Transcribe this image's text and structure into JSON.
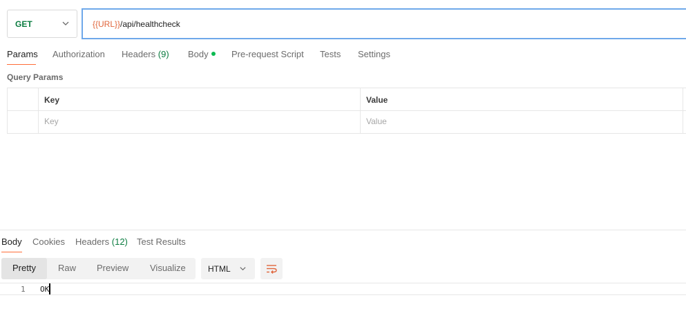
{
  "request": {
    "method": "GET",
    "url_variable": "{{URL}}",
    "url_path": "/api/healthcheck"
  },
  "request_tabs": {
    "params": "Params",
    "authorization": "Authorization",
    "headers": "Headers",
    "headers_count": "(9)",
    "body": "Body",
    "pre_request_script": "Pre-request Script",
    "tests": "Tests",
    "settings": "Settings"
  },
  "query_params": {
    "title": "Query Params",
    "columns": [
      "Key",
      "Value"
    ],
    "placeholders": [
      "Key",
      "Value"
    ]
  },
  "response_tabs": {
    "body": "Body",
    "cookies": "Cookies",
    "headers": "Headers",
    "headers_count": "(12)",
    "test_results": "Test Results"
  },
  "response_format": {
    "modes": [
      "Pretty",
      "Raw",
      "Preview",
      "Visualize"
    ],
    "active_mode": "Pretty",
    "language": "HTML"
  },
  "response_body": {
    "lines": [
      {
        "number": "1",
        "text": "OK"
      }
    ]
  },
  "colors": {
    "method_get": "#0b7c40",
    "url_variable": "#e0653b",
    "accent": "#ff6c37",
    "url_focus_border": "#6ea8ea",
    "body_dot": "#0cbb52"
  },
  "icons": {
    "method_dropdown": "chevron-down-icon",
    "language_dropdown": "chevron-down-icon",
    "wrap_lines": "wrap-lines-icon"
  }
}
